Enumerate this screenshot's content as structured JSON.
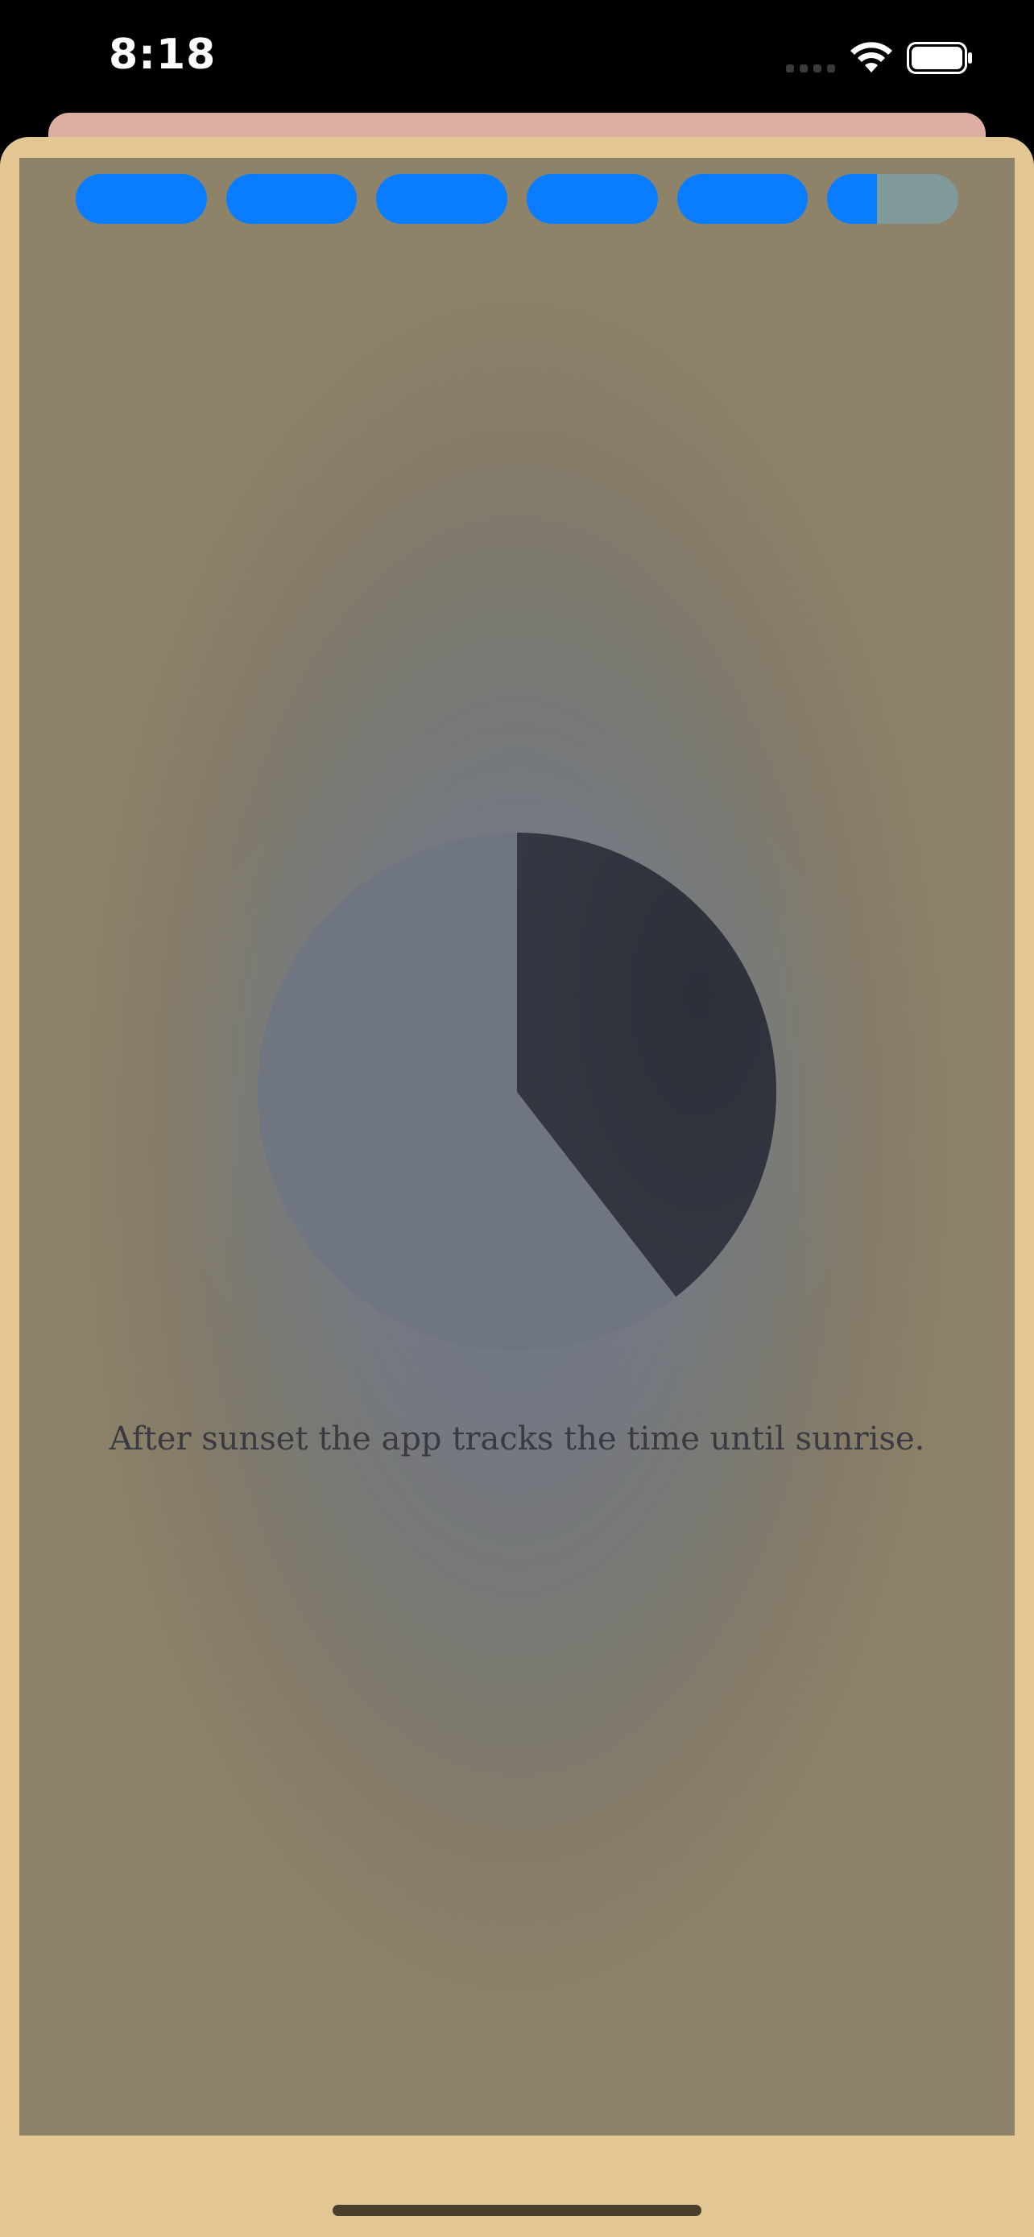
{
  "status_bar": {
    "time": "8:18",
    "icons": [
      "cellular-signal-icon",
      "wifi-icon",
      "battery-icon"
    ]
  },
  "progress": {
    "segments": [
      1,
      1,
      1,
      1,
      1,
      0.38
    ],
    "fill_color": "#0a7cff",
    "track_color": "#7f9a99"
  },
  "pie": {
    "dark_fraction": 0.395,
    "dark_color": "#2f333d",
    "light_color": "#6f7681"
  },
  "caption": "After sunset the app tracks the time until sunrise.",
  "colors": {
    "sheet": "#e2c794",
    "back_card": "#dcaea1"
  }
}
